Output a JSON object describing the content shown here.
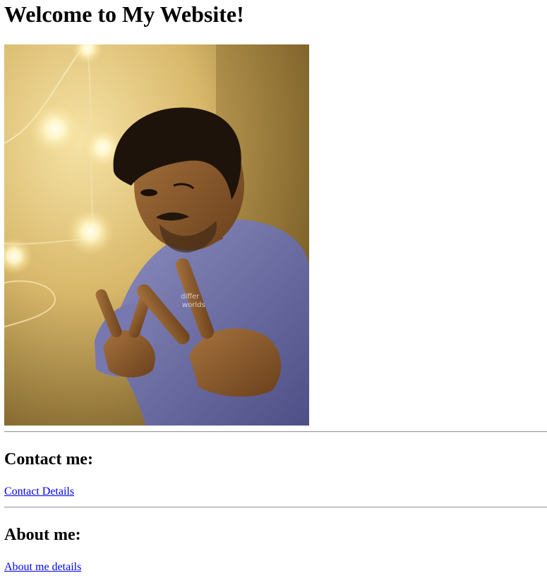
{
  "page": {
    "title": "Welcome to My Website!"
  },
  "photo": {
    "alt": "Portrait photo of a young man flashing peace signs with both hands in front of a wall with warm string lights"
  },
  "contact": {
    "heading": "Contact me:",
    "link_label": "Contact Details"
  },
  "about": {
    "heading": "About me:",
    "link_label": "About me details"
  },
  "colors": {
    "link": "#0000ee",
    "divider": "#9a9a9a"
  }
}
